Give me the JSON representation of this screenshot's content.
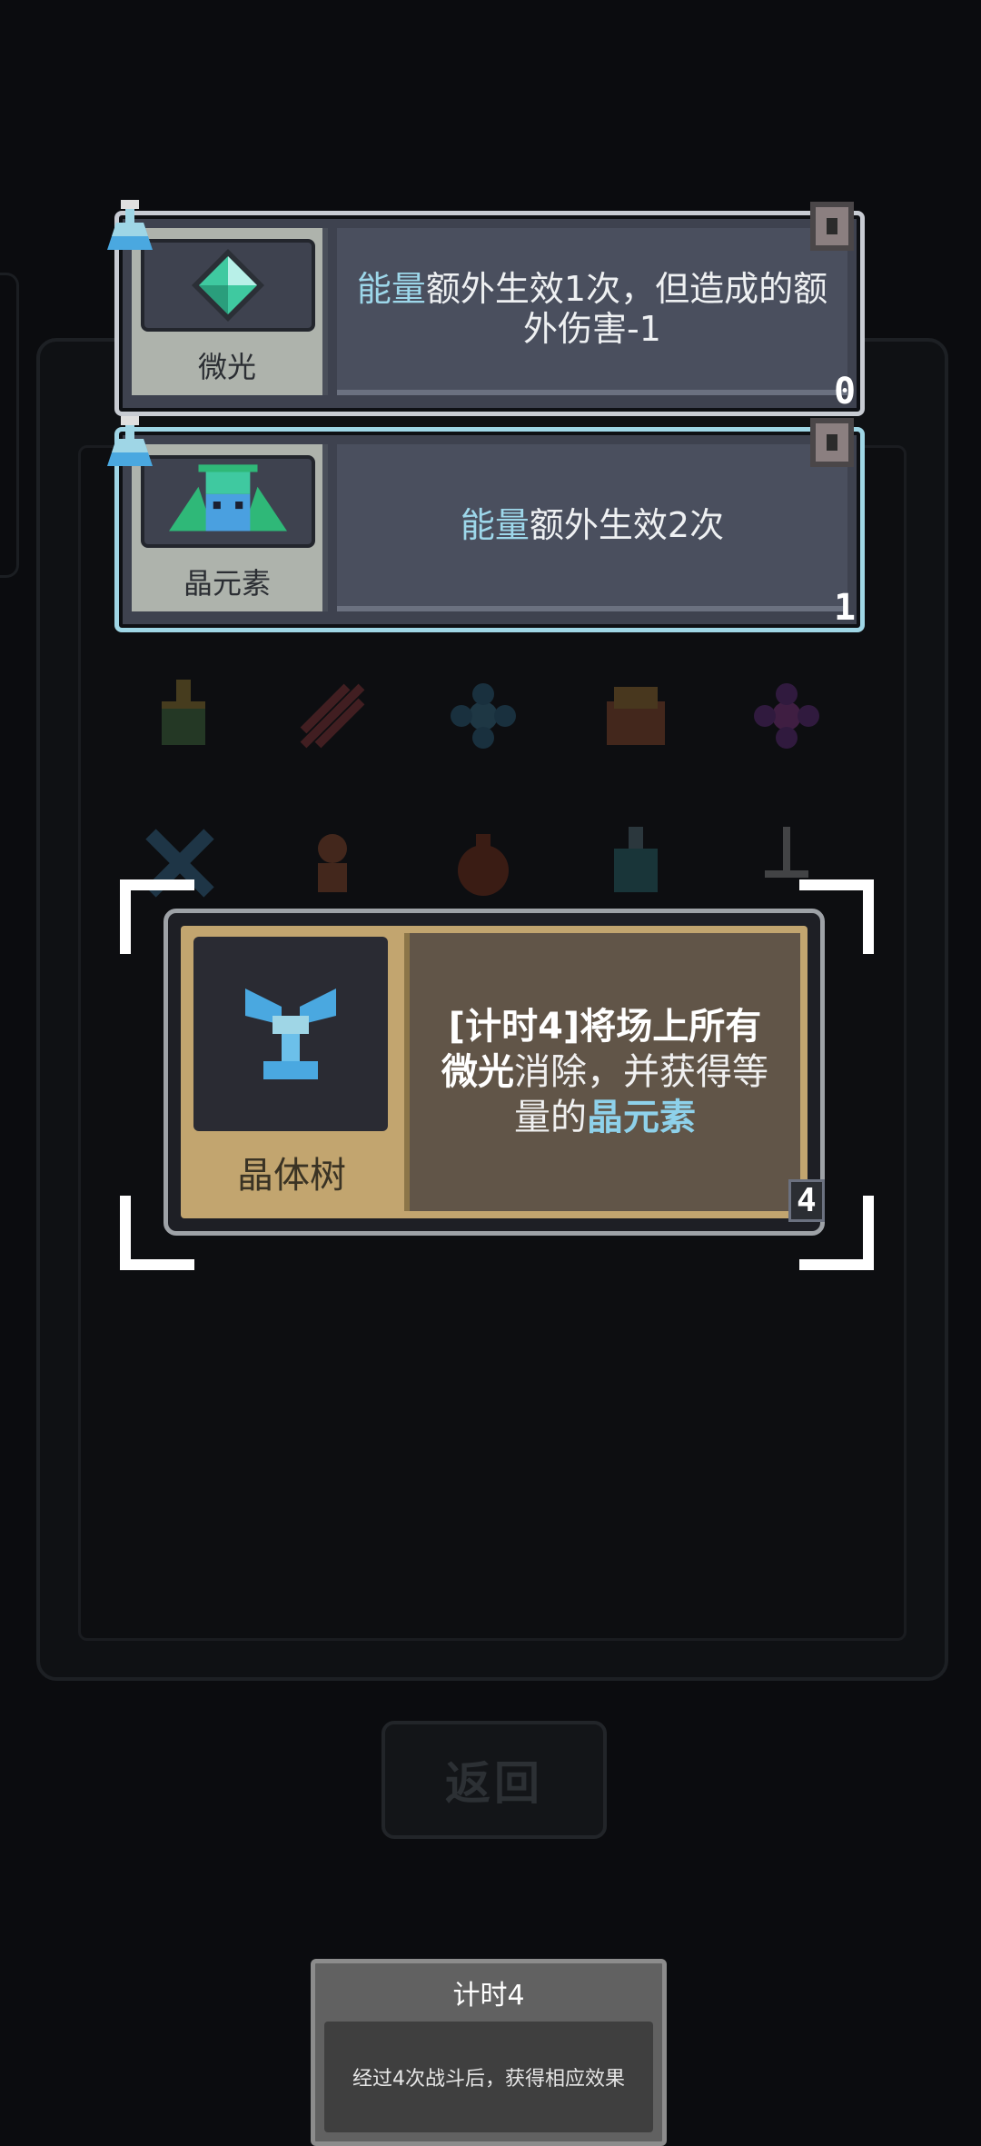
{
  "relics": [
    {
      "name": "微光",
      "desc_highlight": "能量",
      "desc_rest": "额外生效1次，但造成的额外伤害-1",
      "badge": "0",
      "selected": false,
      "icon": "green-diamond-icon"
    },
    {
      "name": "晶元素",
      "desc_highlight": "能量",
      "desc_rest": "额外生效2次",
      "badge": "1",
      "selected": true,
      "icon": "crystal-elemental-icon"
    }
  ],
  "focus_card": {
    "name": "晶体树",
    "icon": "crystal-tree-icon",
    "desc_part1": "[计时4]将场上所有",
    "desc_bold1": "微光",
    "desc_part2": "消除，并获得等量的",
    "desc_highlight": "晶元素",
    "badge": "4"
  },
  "background": {
    "return_label": "返回"
  },
  "tooltip": {
    "title": "计时4",
    "body": "经过4次战斗后，获得相应效果"
  },
  "colors": {
    "highlight": "#9dd7ea",
    "relic_card_bg": "#3e424f",
    "focus_card_gold": "#c2a56f"
  }
}
